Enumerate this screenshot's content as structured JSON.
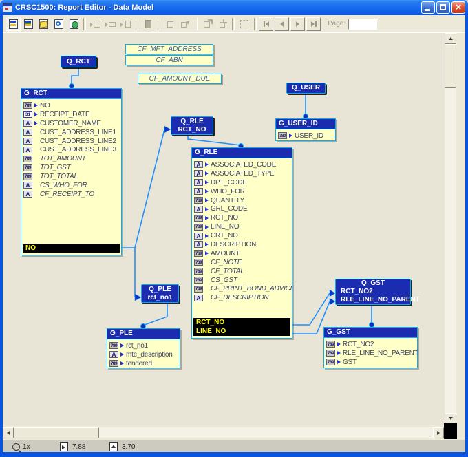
{
  "window": {
    "title": "CRSC1500: Report Editor - Data Model"
  },
  "toolbar": {
    "page_label": "Page:",
    "page_value": "",
    "button_groups": [
      [
        {
          "name": "data-model-view-button",
          "icon": "data-model",
          "state": "active"
        },
        {
          "name": "paper-layout-view-button",
          "icon": "paper-layout",
          "state": "enabled"
        },
        {
          "name": "paper-design-view-button",
          "icon": "paper-design",
          "state": "enabled"
        },
        {
          "name": "parameter-form-view-button",
          "icon": "parameter-form",
          "state": "enabled"
        },
        {
          "name": "web-source-view-button",
          "icon": "web-source",
          "state": "enabled"
        }
      ],
      [
        {
          "name": "frame-tool-1-button",
          "icon": "frame1",
          "state": "disabled"
        },
        {
          "name": "frame-tool-2-button",
          "icon": "frame2",
          "state": "disabled"
        },
        {
          "name": "frame-tool-3-button",
          "icon": "frame3",
          "state": "disabled"
        }
      ],
      [
        {
          "name": "format-painter-button",
          "icon": "painter",
          "state": "disabled"
        }
      ],
      [
        {
          "name": "select-parent-button",
          "icon": "square",
          "state": "disabled"
        },
        {
          "name": "select-child-button",
          "icon": "square-arrow",
          "state": "disabled"
        }
      ],
      [
        {
          "name": "expand-tool-button",
          "icon": "expand",
          "state": "disabled"
        },
        {
          "name": "contract-tool-button",
          "icon": "contract",
          "state": "disabled"
        }
      ],
      [
        {
          "name": "selection-tool-button",
          "icon": "selection",
          "state": "disabled"
        }
      ],
      [
        {
          "name": "first-page-button",
          "icon": "nav-first",
          "state": "disabled"
        },
        {
          "name": "previous-page-button",
          "icon": "nav-prev",
          "state": "disabled"
        },
        {
          "name": "next-page-button",
          "icon": "nav-next",
          "state": "disabled"
        },
        {
          "name": "last-page-button",
          "icon": "nav-last",
          "state": "disabled"
        }
      ]
    ]
  },
  "canvas": {
    "formulas": [
      {
        "label": "CF_MFT_ADDRESS"
      },
      {
        "label": "CF_ABN"
      },
      {
        "label": "CF_AMOUNT_DUE"
      }
    ],
    "queries": [
      {
        "id": "Q_RCT",
        "lines": [
          "Q_RCT"
        ]
      },
      {
        "id": "Q_USER",
        "lines": [
          "Q_USER"
        ]
      },
      {
        "id": "Q_RLE",
        "lines": [
          "Q_RLE",
          "RCT_NO"
        ]
      },
      {
        "id": "Q_PLE",
        "lines": [
          "Q_PLE",
          "rct_no1"
        ]
      },
      {
        "id": "Q_GST",
        "lines": [
          "Q_GST",
          "RCT_NO2",
          "RLE_LINE_NO_PARENT"
        ]
      }
    ],
    "groups": [
      {
        "id": "G_RCT",
        "title": "G_RCT",
        "fields": [
          {
            "icon": "num",
            "arrow": true,
            "label": "NO"
          },
          {
            "icon": "date",
            "arrow": true,
            "label": "RECEIPT_DATE"
          },
          {
            "icon": "char",
            "arrow": true,
            "label": "CUSTOMER_NAME"
          },
          {
            "icon": "char",
            "arrow": false,
            "label": "CUST_ADDRESS_LINE1"
          },
          {
            "icon": "char",
            "arrow": false,
            "label": "CUST_ADDRESS_LINE2"
          },
          {
            "icon": "char",
            "arrow": false,
            "label": "CUST_ADDRESS_LINE3"
          },
          {
            "icon": "num",
            "arrow": false,
            "label": "TOT_AMOUNT",
            "italic": true
          },
          {
            "icon": "num",
            "arrow": false,
            "label": "TOT_GST",
            "italic": true
          },
          {
            "icon": "num",
            "arrow": false,
            "label": "TOT_TOTAL",
            "italic": true
          },
          {
            "icon": "char",
            "arrow": false,
            "label": "CS_WHO_FOR",
            "italic": true
          },
          {
            "icon": "char",
            "arrow": false,
            "label": "CF_RECEIPT_TO",
            "italic": true
          }
        ],
        "break_columns": [
          "NO"
        ]
      },
      {
        "id": "G_USER_ID",
        "title": "G_USER_ID",
        "fields": [
          {
            "icon": "num",
            "arrow": true,
            "label": "USER_ID"
          }
        ],
        "break_columns": []
      },
      {
        "id": "G_RLE",
        "title": "G_RLE",
        "fields": [
          {
            "icon": "char",
            "arrow": true,
            "label": "ASSOCIATED_CODE"
          },
          {
            "icon": "char",
            "arrow": true,
            "label": "ASSOCIATED_TYPE"
          },
          {
            "icon": "char",
            "arrow": true,
            "label": "DPT_CODE"
          },
          {
            "icon": "char",
            "arrow": true,
            "label": "WHO_FOR"
          },
          {
            "icon": "num",
            "arrow": true,
            "label": "QUANTITY"
          },
          {
            "icon": "char",
            "arrow": true,
            "label": "GRL_CODE"
          },
          {
            "icon": "num",
            "arrow": true,
            "label": "RCT_NO"
          },
          {
            "icon": "num",
            "arrow": true,
            "label": "LINE_NO"
          },
          {
            "icon": "char",
            "arrow": true,
            "label": "CRT_NO"
          },
          {
            "icon": "char",
            "arrow": true,
            "label": "DESCRIPTION"
          },
          {
            "icon": "num",
            "arrow": true,
            "label": "AMOUNT"
          },
          {
            "icon": "num",
            "arrow": false,
            "label": "CF_NOTE",
            "italic": true
          },
          {
            "icon": "num",
            "arrow": false,
            "label": "CF_TOTAL",
            "italic": true
          },
          {
            "icon": "num",
            "arrow": false,
            "label": "CS_GST",
            "italic": true
          },
          {
            "icon": "num",
            "arrow": false,
            "label": "CF_PRINT_BOND_ADVICE",
            "italic": true
          },
          {
            "icon": "char",
            "arrow": false,
            "label": "CF_DESCRIPTION",
            "italic": true
          }
        ],
        "break_columns": [
          "RCT_NO",
          "LINE_NO"
        ]
      },
      {
        "id": "G_PLE",
        "title": "G_PLE",
        "fields": [
          {
            "icon": "num",
            "arrow": true,
            "label": "rct_no1"
          },
          {
            "icon": "char",
            "arrow": true,
            "label": "mte_description"
          },
          {
            "icon": "num",
            "arrow": true,
            "label": "tendered"
          }
        ],
        "break_columns": []
      },
      {
        "id": "G_GST",
        "title": "G_GST",
        "fields": [
          {
            "icon": "num",
            "arrow": true,
            "label": "RCT_NO2"
          },
          {
            "icon": "num",
            "arrow": true,
            "label": "RLE_LINE_NO_PARENT"
          },
          {
            "icon": "num",
            "arrow": true,
            "label": "GST"
          }
        ],
        "break_columns": []
      }
    ]
  },
  "statusbar": {
    "zoom": "1x",
    "x_position": "7.88",
    "y_position": "3.70"
  },
  "colors": {
    "query_fill": "#1b2cb0",
    "group_fill": "#ffffc8",
    "border_cyan": "#00b0f0",
    "link_blue": "#1f8fff",
    "break_bar": "#000000",
    "break_text": "#ffff00",
    "titlebar_blue": "#0a54e0"
  }
}
